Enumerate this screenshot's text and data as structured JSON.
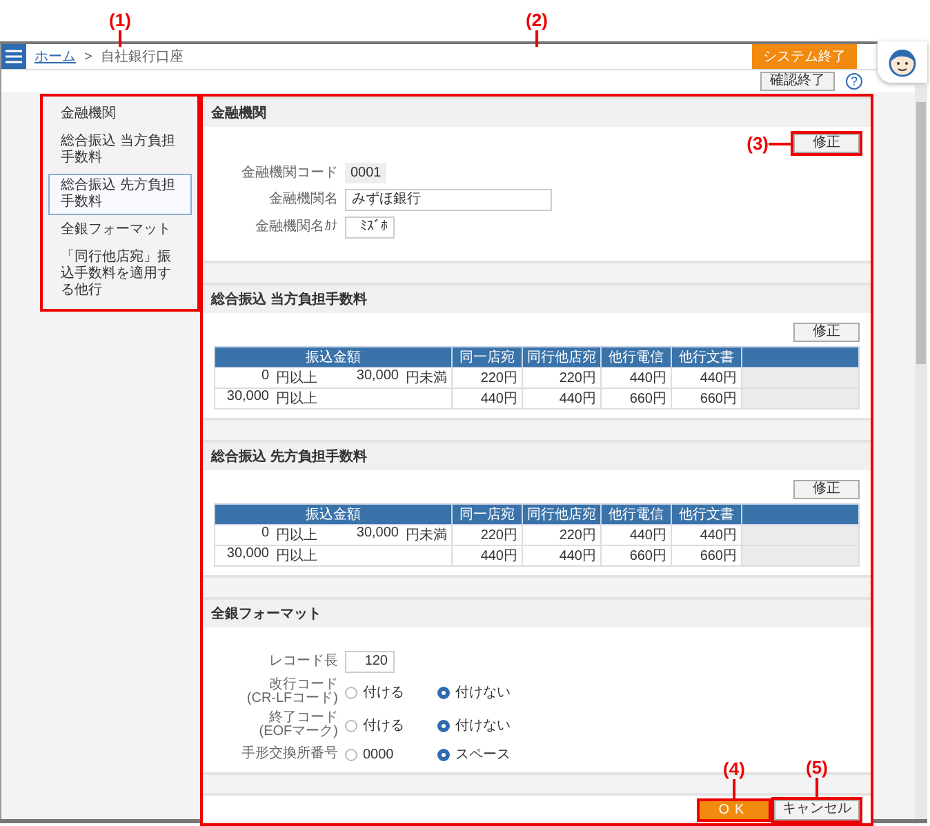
{
  "header": {
    "breadcrumb": [
      {
        "label": "ホーム",
        "kind": "link"
      },
      {
        "label": ">",
        "kind": "separator"
      },
      {
        "label": "自社銀行口座",
        "kind": "current"
      }
    ],
    "exit_button": "システム終了",
    "confirm_button": "確認終了",
    "help_icon": "?"
  },
  "sidebar": {
    "items": [
      {
        "label": "金融機関",
        "selected": false
      },
      {
        "label": "総合振込 当方負担手数料",
        "selected": false
      },
      {
        "label": "総合振込 先方負担手数料",
        "selected": true
      },
      {
        "label": "全銀フォーマット",
        "selected": false
      },
      {
        "label": "「同行他店宛」振込手数料を適用する他行",
        "selected": false
      }
    ]
  },
  "sections": [
    {
      "kind": "bank",
      "title": "金融機関",
      "edit_button": "修正",
      "fields": [
        {
          "label": "金融機関コード",
          "kind": "readonly",
          "value": "0001"
        },
        {
          "label": "金融機関名",
          "kind": "input",
          "value": "みずほ銀行"
        },
        {
          "label": "金融機関名ｶﾅ",
          "kind": "input",
          "value": "ﾐｽﾞﾎ"
        }
      ]
    },
    {
      "kind": "fee_table",
      "title": "総合振込 当方負担手数料",
      "edit_button": "修正",
      "columns": [
        "振込金額",
        "同一店宛",
        "同行他店宛",
        "他行電信",
        "他行文書"
      ],
      "rows": [
        {
          "from": "0",
          "from_unit": "円以上",
          "to": "30,000",
          "to_unit": "円未満",
          "fees": [
            "220円",
            "220円",
            "440円",
            "440円"
          ]
        },
        {
          "from": "30,000",
          "from_unit": "円以上",
          "fees": [
            "440円",
            "440円",
            "660円",
            "660円"
          ]
        }
      ]
    },
    {
      "kind": "fee_table",
      "title": "総合振込 先方負担手数料",
      "edit_button": "修正",
      "columns": [
        "振込金額",
        "同一店宛",
        "同行他店宛",
        "他行電信",
        "他行文書"
      ],
      "rows": [
        {
          "from": "0",
          "from_unit": "円以上",
          "to": "30,000",
          "to_unit": "円未満",
          "fees": [
            "220円",
            "220円",
            "440円",
            "440円"
          ]
        },
        {
          "from": "30,000",
          "from_unit": "円以上",
          "fees": [
            "440円",
            "440円",
            "660円",
            "660円"
          ]
        }
      ]
    },
    {
      "kind": "format",
      "title": "全銀フォーマット",
      "fields": [
        {
          "label": [
            "レコード長"
          ],
          "kind": "input",
          "value": "120"
        },
        {
          "label": [
            "改行コード",
            "(CR-LFコード)"
          ],
          "kind": "radio",
          "options": [
            {
              "label": "付ける",
              "selected": false
            },
            {
              "label": "付けない",
              "selected": true
            }
          ]
        },
        {
          "label": [
            "終了コード",
            "(EOFマーク)"
          ],
          "kind": "radio",
          "options": [
            {
              "label": "付ける",
              "selected": false
            },
            {
              "label": "付けない",
              "selected": true
            }
          ]
        },
        {
          "label": [
            "手形交換所番号"
          ],
          "kind": "radio",
          "options": [
            {
              "label": "0000",
              "selected": false
            },
            {
              "label": "スペース",
              "selected": true
            }
          ]
        }
      ]
    }
  ],
  "footer": {
    "ok_button": "OK",
    "cancel_button": "キャンセル"
  },
  "annotations": {
    "sidebar": "(1)",
    "main": "(2)",
    "edit_button": "(3)",
    "ok_button": "(4)",
    "cancel_button": "(5)"
  }
}
